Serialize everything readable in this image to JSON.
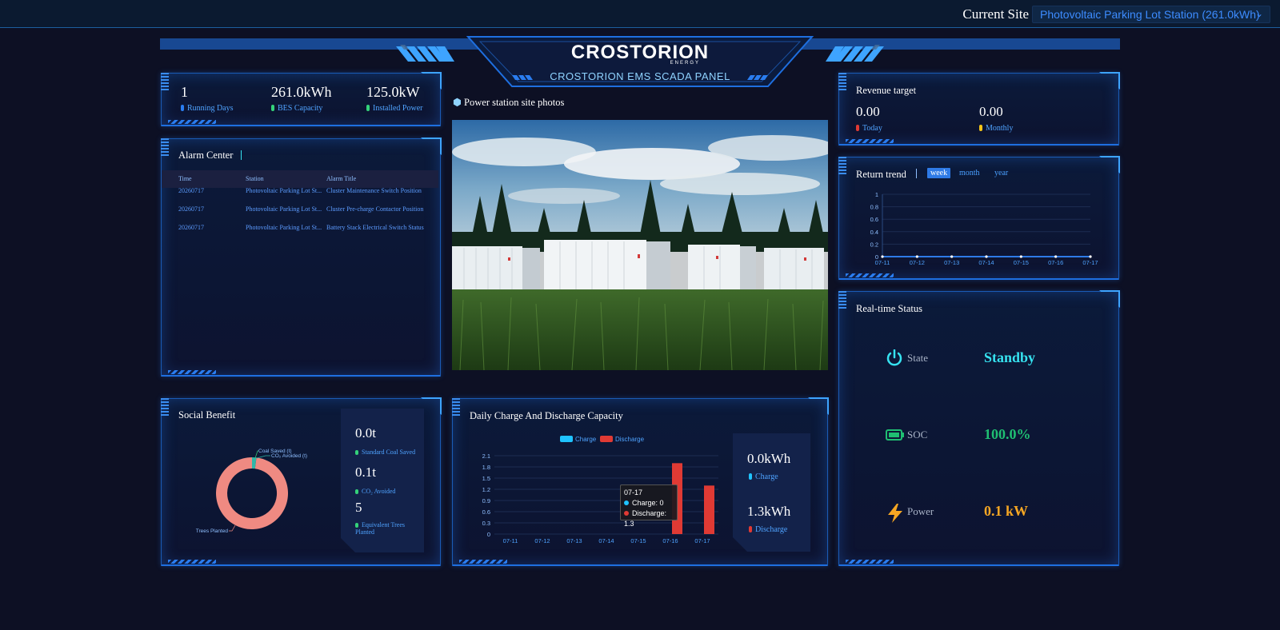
{
  "topbar": {
    "site_label": "Current Site",
    "site_selected": "Photovoltaic Parking Lot Station (261.0kWh)"
  },
  "header": {
    "logo_text": "CROSTORION",
    "logo_sub": "ENERGY",
    "panel_title": "CROSTORION EMS SCADA PANEL"
  },
  "summary": {
    "running_days": "1",
    "running_days_label": "Running Days",
    "bes_capacity": "261.0kWh",
    "bes_capacity_label": "BES Capacity",
    "installed_power": "125.0kW",
    "installed_power_label": "Installed Power"
  },
  "alarm": {
    "title": "Alarm Center",
    "columns": [
      "Time",
      "Station",
      "Alarm Title"
    ],
    "rows": [
      [
        "20260717",
        "Photovoltaic Parking Lot St...",
        "Cluster Maintenance Switch Position"
      ],
      [
        "20260717",
        "Photovoltaic Parking Lot St...",
        "Cluster Pre-charge Contactor Position"
      ],
      [
        "20260717",
        "Photovoltaic Parking Lot St...",
        "Battery Stack Electrical Switch Status"
      ]
    ]
  },
  "photos": {
    "title": "Power station site photos"
  },
  "revenue": {
    "title": "Revenue target",
    "today_value": "0.00",
    "today_label": "Today",
    "monthly_value": "0.00",
    "monthly_label": "Monthly"
  },
  "return_trend": {
    "title": "Return trend",
    "tabs": [
      "week",
      "month",
      "year"
    ],
    "active_tab": "week"
  },
  "realtime": {
    "title": "Real-time Status",
    "state_label": "State",
    "state_value": "Standby",
    "soc_label": "SOC",
    "soc_value": "100.0%",
    "power_label": "Power",
    "power_value": "0.1 kW"
  },
  "social": {
    "title": "Social Benefit",
    "coal_value": "0.0t",
    "coal_label": "Standard Coal Saved",
    "co2_value": "0.1t",
    "co2_label": "CO₂ Avoided",
    "trees_value": "5",
    "trees_label": "Equivalent Trees Planted"
  },
  "daily": {
    "title": "Daily Charge And Discharge Capacity",
    "charge_value": "0.0kWh",
    "charge_label": "Charge",
    "discharge_value": "1.3kWh",
    "discharge_label": "Discharge",
    "tooltip_date": "07-17",
    "tooltip_charge": "Charge: 0",
    "tooltip_discharge": "Discharge: 1.3"
  },
  "colors": {
    "accent": "#3d8cff",
    "charge": "#1fc3ff",
    "discharge": "#e03a34",
    "state": "#36e2f0",
    "soc": "#1fbf72",
    "power": "#f5a623"
  },
  "chart_data": [
    {
      "type": "line",
      "categories": [
        "07-11",
        "07-12",
        "07-13",
        "07-14",
        "07-15",
        "07-16",
        "07-17"
      ],
      "series": [
        {
          "values": [
            0,
            0,
            0,
            0,
            0,
            0,
            0
          ]
        }
      ],
      "yticks": [
        0,
        0.2,
        0.4,
        0.6,
        0.8,
        1
      ],
      "ylim": [
        0,
        1
      ],
      "grid": true
    },
    {
      "type": "bar",
      "categories": [
        "07-11",
        "07-12",
        "07-13",
        "07-14",
        "07-15",
        "07-16",
        "07-17"
      ],
      "series": [
        {
          "name": "Charge",
          "values": [
            0,
            0,
            0,
            0,
            0,
            0,
            0
          ]
        },
        {
          "name": "Discharge",
          "values": [
            0,
            0,
            0,
            0,
            0,
            1.9,
            1.3
          ]
        }
      ],
      "yticks": [
        0,
        0.3,
        0.6,
        0.9,
        1.2,
        1.5,
        1.8,
        2.1
      ],
      "ylim": [
        0,
        2.1
      ],
      "legend": "top-center",
      "grid": true
    },
    {
      "type": "pie",
      "labels": [
        "Coal Saved (t)",
        "CO₂ Avoided (t)",
        "Trees Planted"
      ],
      "values": [
        0.0,
        0.1,
        5
      ]
    }
  ]
}
